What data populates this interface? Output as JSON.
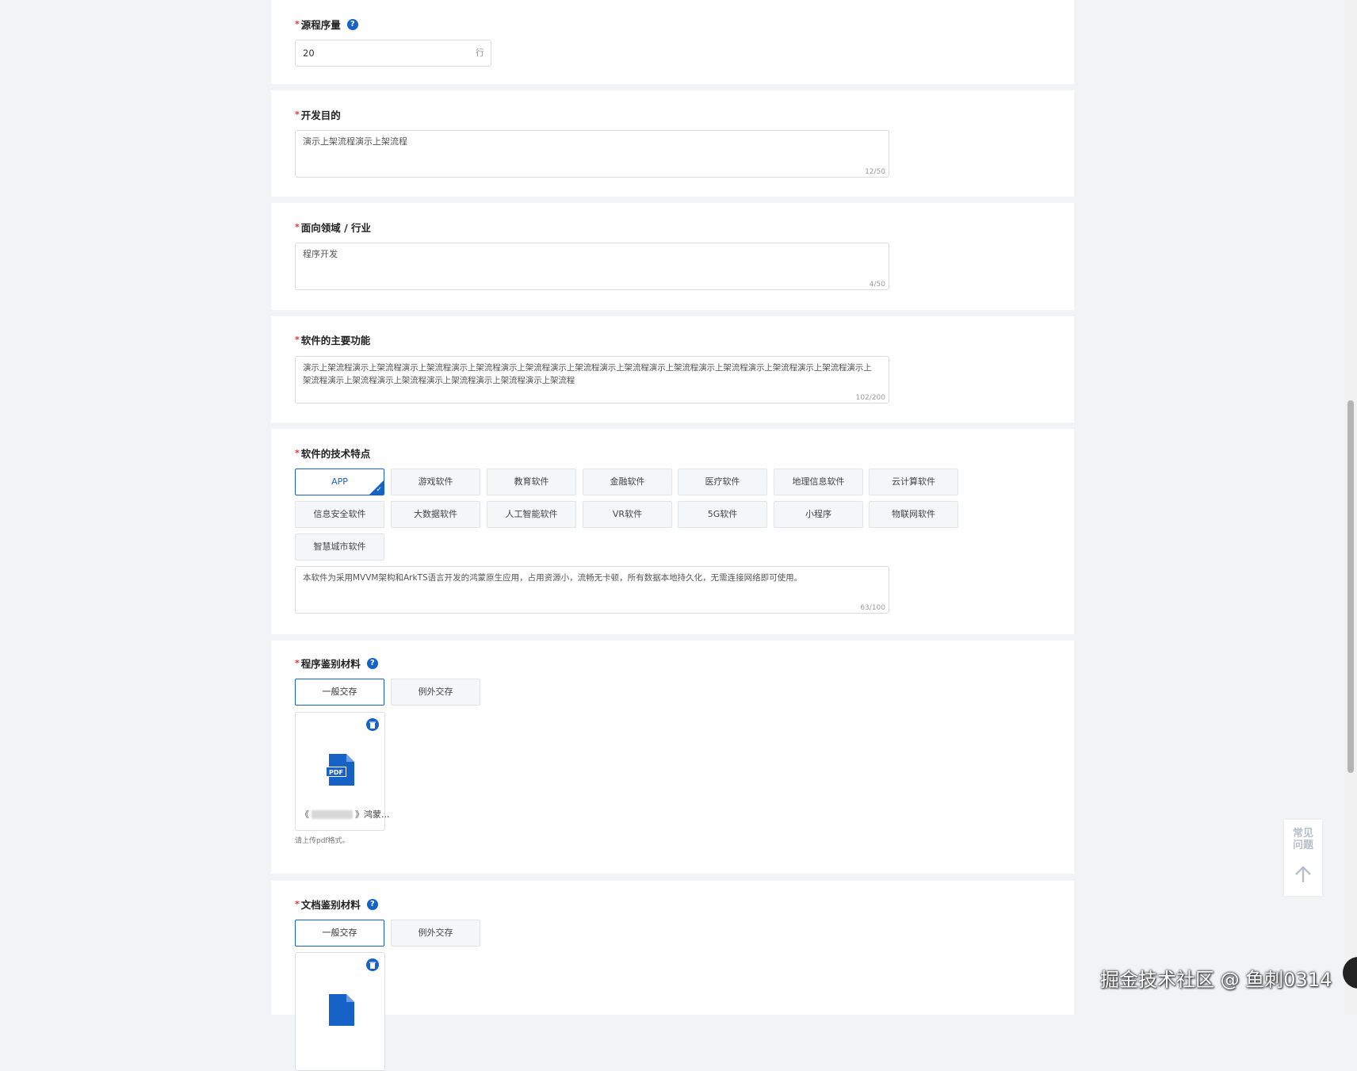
{
  "source_lines": {
    "label": "源程序量",
    "value": "20",
    "unit": "行"
  },
  "purpose": {
    "label": "开发目的",
    "text": "演示上架流程演示上架流程",
    "count": "12/50"
  },
  "industry": {
    "label": "面向领域 / 行业",
    "text": "程序开发",
    "count": "4/50"
  },
  "main_features": {
    "label": "软件的主要功能",
    "text": "演示上架流程演示上架流程演示上架流程演示上架流程演示上架流程演示上架流程演示上架流程演示上架流程演示上架流程演示上架流程演示上架流程演示上架流程演示上架流程演示上架流程演示上架流程演示上架流程演示上架流程",
    "count": "102/200"
  },
  "tech_features": {
    "label": "软件的技术特点",
    "options": [
      "APP",
      "游戏软件",
      "教育软件",
      "金融软件",
      "医疗软件",
      "地理信息软件",
      "云计算软件",
      "信息安全软件",
      "大数据软件",
      "人工智能软件",
      "VR软件",
      "5G软件",
      "小程序",
      "物联网软件",
      "智慧城市软件"
    ],
    "selected": "APP",
    "text": "本软件为采用MVVM架构和ArkTS语言开发的鸿蒙原生应用，占用资源小，流畅无卡顿，所有数据本地持久化，无需连接网络即可使用。",
    "count": "63/100"
  },
  "program_material": {
    "label": "程序鉴别材料",
    "tabs": [
      "一般交存",
      "例外交存"
    ],
    "selected": "一般交存",
    "file_prefix": "《",
    "file_suffix": "》鸿蒙...",
    "hint": "请上传pdf格式。"
  },
  "doc_material": {
    "label": "文档鉴别材料",
    "tabs": [
      "一般交存",
      "例外交存"
    ],
    "selected": "一般交存"
  },
  "float_panel": {
    "faq": "常见\n问题"
  },
  "watermark": "掘金技术社区 @ 鱼刺0314",
  "colors": {
    "accent": "#1662c6",
    "required": "#e0363b",
    "page_bg": "#f1f3f5"
  }
}
